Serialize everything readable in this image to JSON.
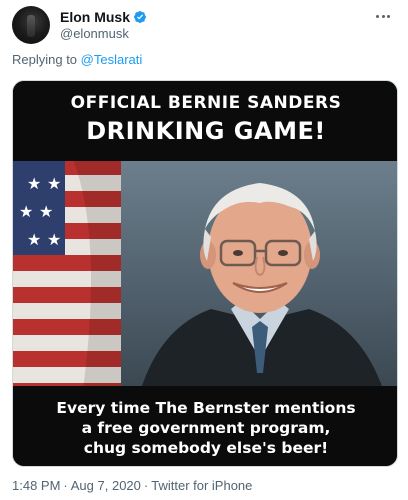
{
  "author": {
    "display_name": "Elon Musk",
    "handle": "@elonmusk",
    "verified": true,
    "avatar_icon": "avatar-photo"
  },
  "reply": {
    "prefix": "Replying to",
    "handle": "@Teslarati"
  },
  "media": {
    "headline_line1": "OFFICIAL BERNIE SANDERS",
    "headline_line2": "DRINKING GAME!",
    "caption": "Every time The Bernster mentions\na free government program,\nchug somebody else's beer!"
  },
  "meta": {
    "time": "1:48 PM",
    "separator": "·",
    "date": "Aug 7, 2020",
    "source": "Twitter for iPhone"
  },
  "colors": {
    "link": "#1d9bf0",
    "muted": "#536471",
    "text": "#0f1419",
    "verified": "#1d9bf0"
  }
}
